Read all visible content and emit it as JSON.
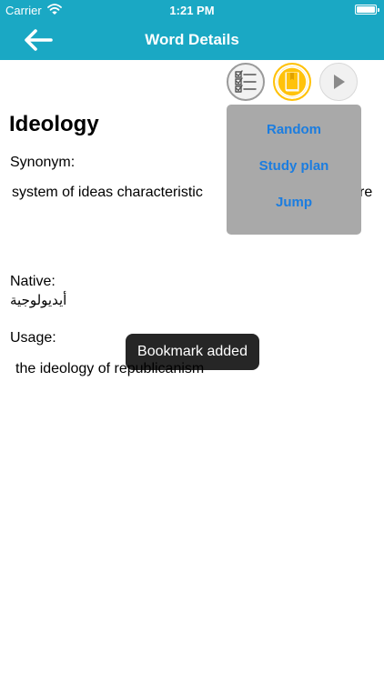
{
  "status_bar": {
    "carrier": "Carrier",
    "time": "1:21 PM"
  },
  "nav": {
    "title": "Word Details"
  },
  "menu": {
    "items": [
      "Random",
      "Study plan",
      "Jump"
    ]
  },
  "word": {
    "term": "Ideology",
    "synonym_label": "Synonym:",
    "synonym_value": "system of ideas characteristic",
    "synonym_tail": "re",
    "native_label": "Native:",
    "native_value": "أيديولوجية",
    "usage_label": "Usage:",
    "usage_value": "the ideology of republicanism"
  },
  "toast": {
    "message": "Bookmark added"
  },
  "colors": {
    "header": "#1aa8c4",
    "bookmark_active": "#ffc20a",
    "menu_background": "#a9a9a9",
    "menu_text": "#1b7de0"
  }
}
